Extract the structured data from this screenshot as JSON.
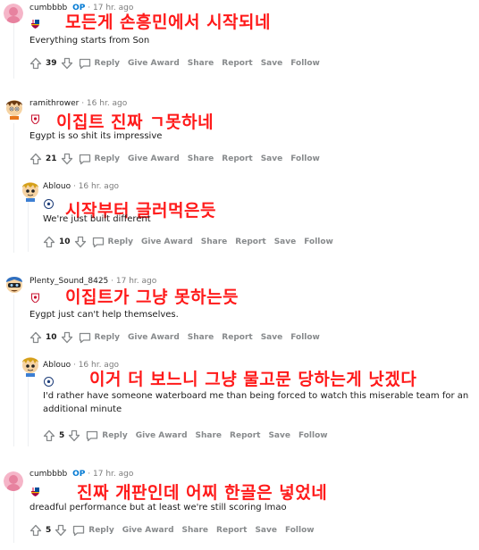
{
  "actions": {
    "reply": "Reply",
    "give_award": "Give Award",
    "share": "Share",
    "report": "Report",
    "save": "Save",
    "follow": "Follow"
  },
  "comments": [
    {
      "user": "cumbbbb",
      "op": "OP",
      "time": "· 17 hr. ago",
      "korean": "모든게 손흥민에서 시작되네",
      "text": "Everything starts from Son",
      "score": "39"
    },
    {
      "user": "ramithrower",
      "time": "· 16 hr. ago",
      "korean": "이집트 진짜 ㄱ못하네",
      "text": "Egypt is so shit its impressive",
      "score": "21"
    },
    {
      "user": "Ablouo",
      "time": "· 16 hr. ago",
      "korean": "시작부터 글러먹은듯",
      "text": "We're just built different",
      "score": "10"
    },
    {
      "user": "Plenty_Sound_8425",
      "time": "· 17 hr. ago",
      "korean": "이집트가 그냥 못하는듯",
      "text": "Eygpt just can't help themselves.",
      "score": "10"
    },
    {
      "user": "Ablouo",
      "time": "· 16 hr. ago",
      "korean": "이거 더 보느니 그냥 물고문 당하는게 낫겠다",
      "text_line1": "I'd rather have someone waterboard me than being forced to watch this miserable team for an",
      "text_line2": "additional minute",
      "score": "5"
    },
    {
      "user": "cumbbbb",
      "op": "OP",
      "time": "· 17 hr. ago",
      "korean": "진짜 개판인데 어찌 한골은 넣었네",
      "text": "dreadful performance but at least we're still scoring lmao",
      "score": "5"
    }
  ]
}
